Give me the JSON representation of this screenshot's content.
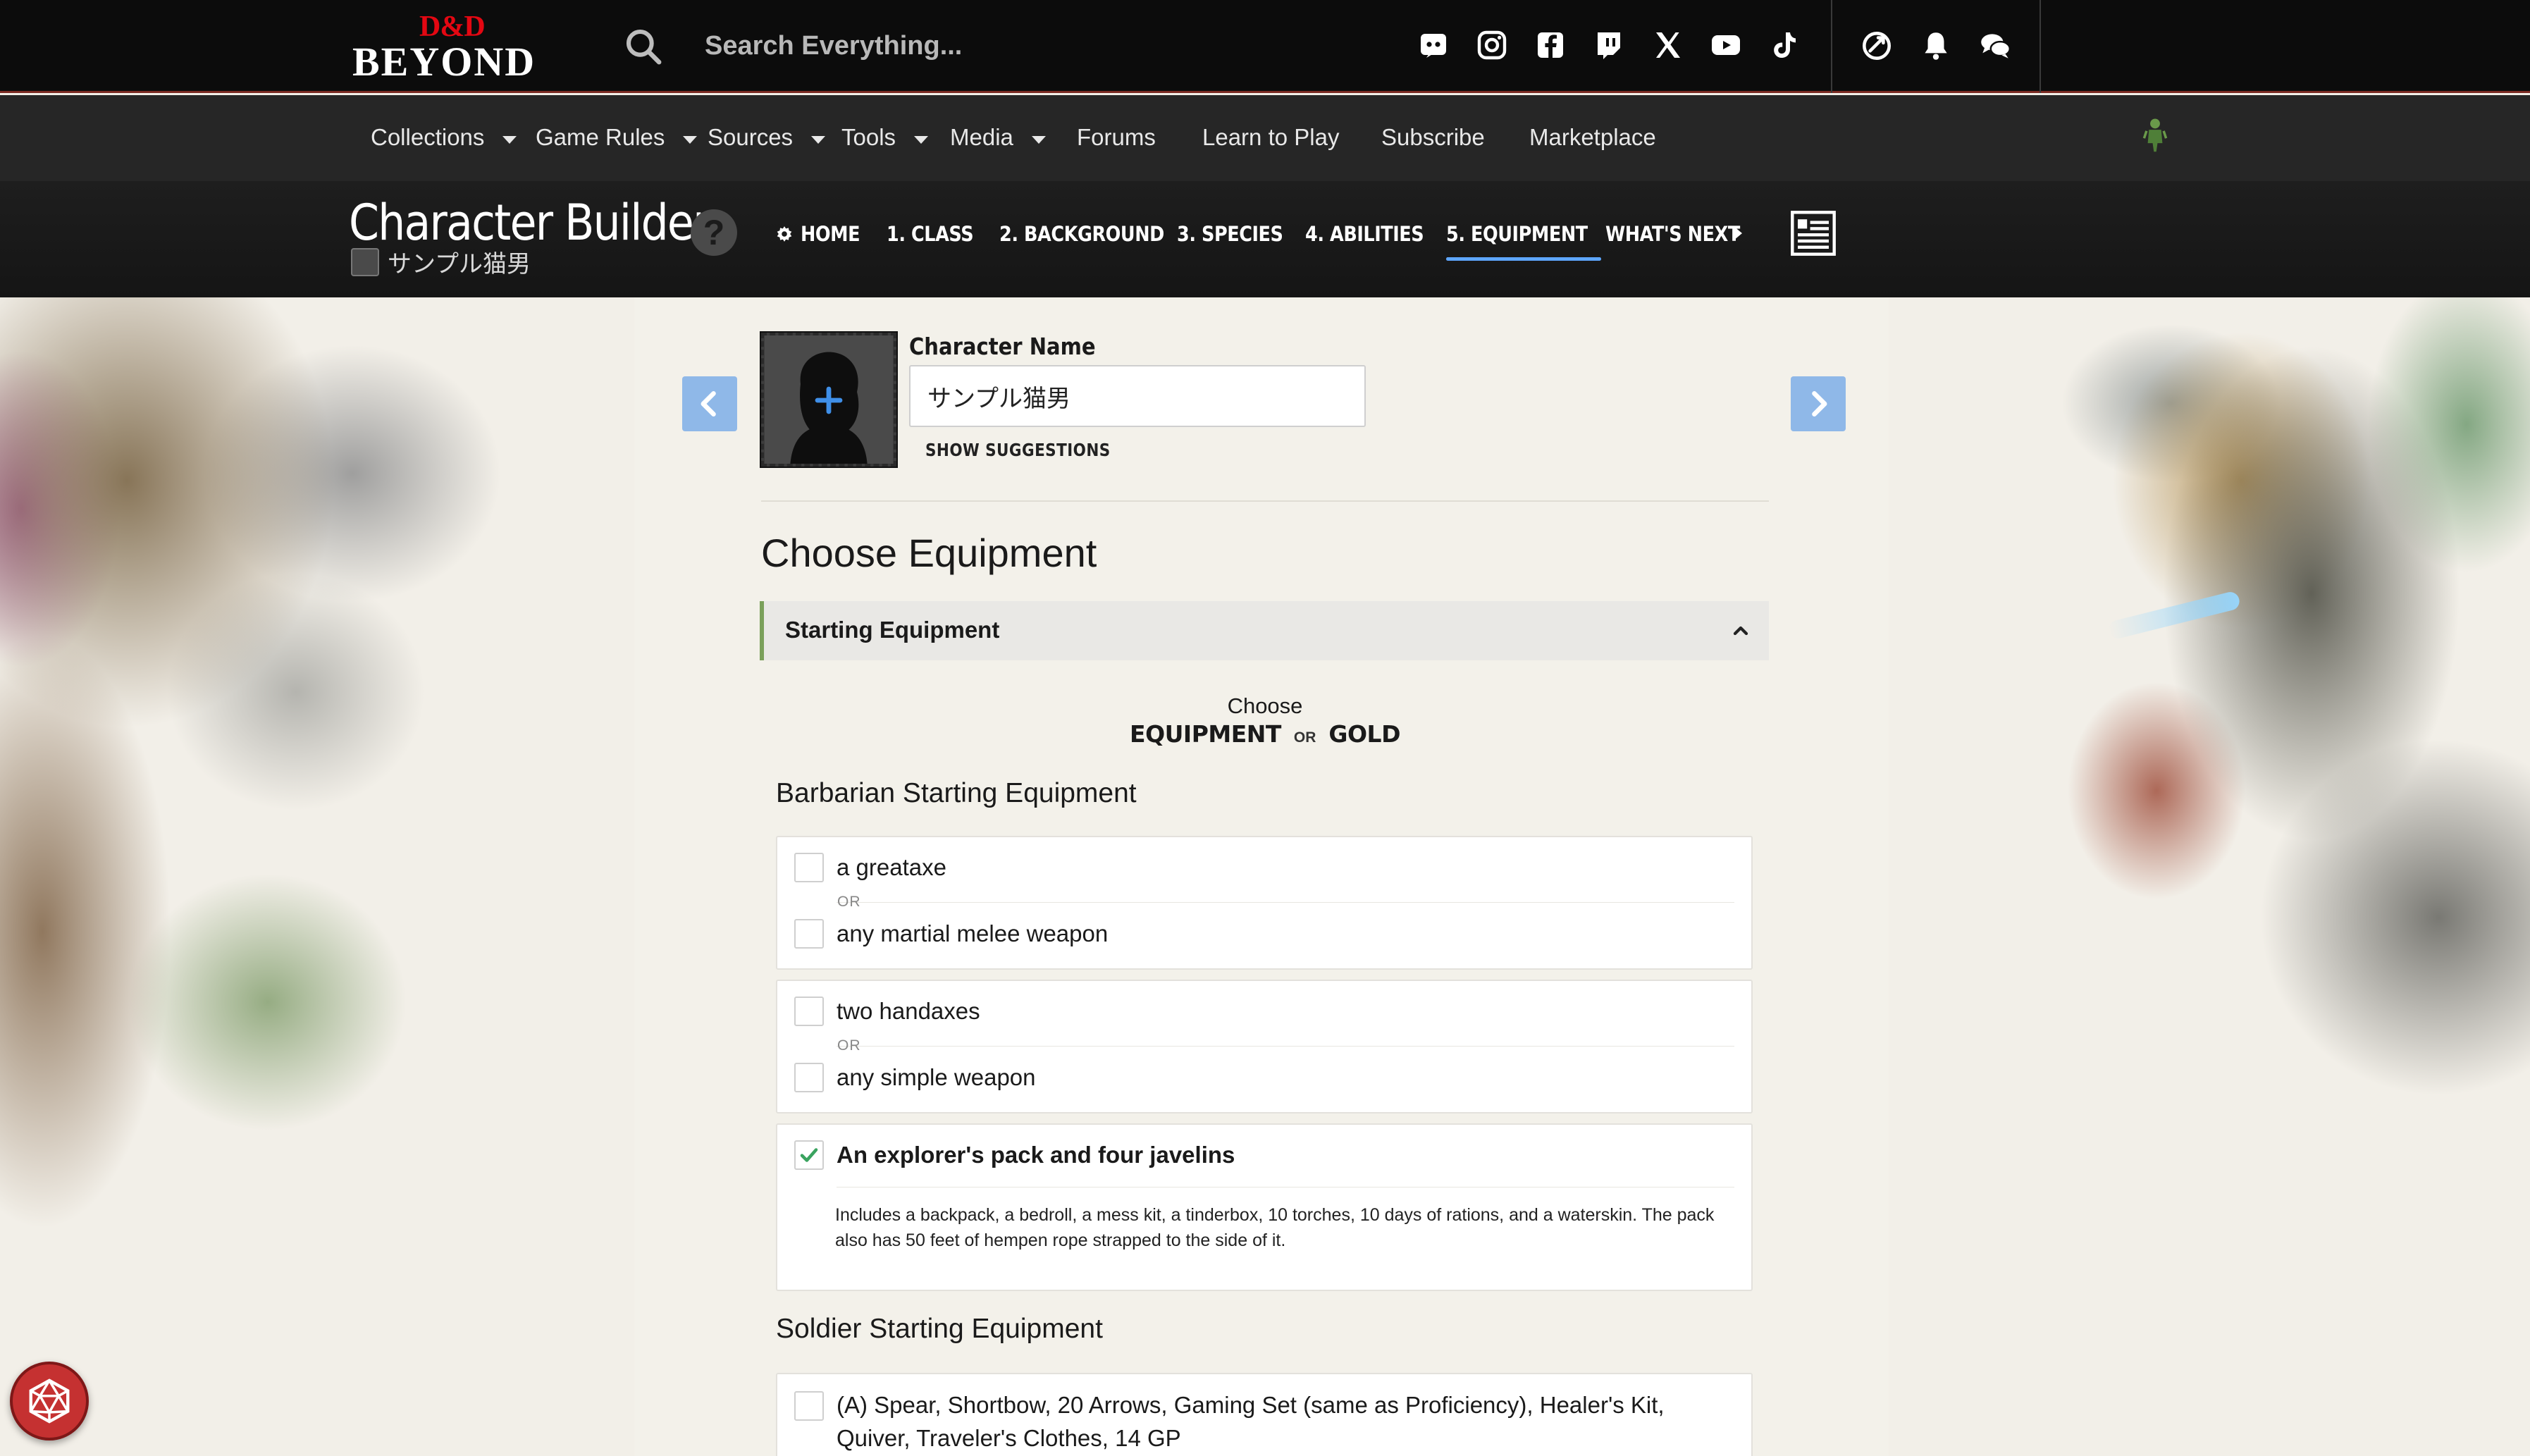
{
  "header": {
    "logo_top": "D&D",
    "logo_bottom": "BEYOND",
    "search_placeholder": "Search Everything...",
    "social_icons": [
      "discord-icon",
      "instagram-icon",
      "facebook-icon",
      "twitch-icon",
      "x-icon",
      "youtube-icon",
      "tiktok-icon"
    ],
    "actions": [
      "quick-roll-icon",
      "bell-icon",
      "chat-icon"
    ]
  },
  "nav": {
    "items": [
      {
        "label": "Collections",
        "dropdown": true
      },
      {
        "label": "Game Rules",
        "dropdown": true
      },
      {
        "label": "Sources",
        "dropdown": true
      },
      {
        "label": "Tools",
        "dropdown": true
      },
      {
        "label": "Media",
        "dropdown": true
      },
      {
        "label": "Forums",
        "dropdown": false
      },
      {
        "label": "Learn to Play",
        "dropdown": false
      },
      {
        "label": "Subscribe",
        "dropdown": false
      },
      {
        "label": "Marketplace",
        "dropdown": false
      }
    ]
  },
  "builder": {
    "title": "Character Builder",
    "character": "サンプル猫男",
    "help": "?",
    "steps": [
      {
        "label": "HOME",
        "active": false
      },
      {
        "label": "1. CLASS",
        "active": false
      },
      {
        "label": "2. BACKGROUND",
        "active": false
      },
      {
        "label": "3. SPECIES",
        "active": false
      },
      {
        "label": "4. ABILITIES",
        "active": false
      },
      {
        "label": "5. EQUIPMENT",
        "active": true
      },
      {
        "label": "WHAT'S NEXT",
        "active": false
      }
    ]
  },
  "character_name": {
    "label": "Character Name",
    "value": "サンプル猫男",
    "suggestions": "SHOW SUGGESTIONS"
  },
  "equipment": {
    "title": "Choose Equipment",
    "section": "Starting Equipment",
    "choose_label": "Choose",
    "choice_a": "EQUIPMENT",
    "choice_or": "OR",
    "choice_b": "GOLD",
    "or_text": "OR",
    "barbarian": {
      "title": "Barbarian Starting Equipment",
      "group1": [
        {
          "label": "a greataxe",
          "checked": false
        },
        {
          "label": "any martial melee weapon",
          "checked": false
        }
      ],
      "group2": [
        {
          "label": "two handaxes",
          "checked": false
        },
        {
          "label": "any simple weapon",
          "checked": false
        }
      ],
      "pack": {
        "label": "An explorer's pack and four javelins",
        "checked": true,
        "description": "Includes a backpack, a bedroll, a mess kit, a tinderbox, 10 torches, 10 days of rations, and a waterskin. The pack also has 50 feet of hempen rope strapped to the side of it."
      }
    },
    "soldier": {
      "title": "Soldier Starting Equipment",
      "option_a": "(A) Spear, Shortbow, 20 Arrows, Gaming Set (same as Proficiency), Healer's Kit, Quiver, Traveler's Clothes, 14 GP",
      "checked": false
    }
  },
  "colors": {
    "accent_blue": "#5ea6ff",
    "arrow_blue": "#8fb8e8",
    "check_green": "#3aa35f",
    "section_bar": "#7aa05a",
    "brand_red": "#e40712"
  }
}
